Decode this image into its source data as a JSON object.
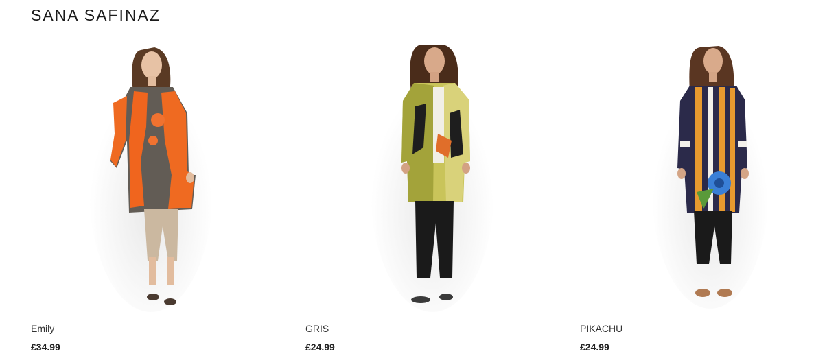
{
  "brand": {
    "title": "SANA SAFINAZ"
  },
  "products": [
    {
      "name": "Emily",
      "price": "£34.99",
      "image_icon": "model-orange-floral-tunic"
    },
    {
      "name": "GRIS",
      "price": "£24.99",
      "image_icon": "model-green-print-shirt"
    },
    {
      "name": "PIKACHU",
      "price": "£24.99",
      "image_icon": "model-striped-tunic-blue-flower"
    }
  ],
  "colors": {
    "text": "#222222",
    "background": "#ffffff"
  }
}
